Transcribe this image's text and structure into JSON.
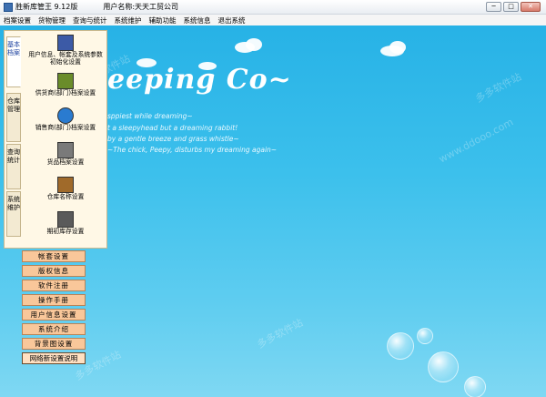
{
  "window": {
    "title": "胜新库管王  9.12版",
    "company": "用户名称:天天工贸公司",
    "controls": [
      "─",
      "□",
      "✕"
    ]
  },
  "menu": {
    "items": [
      "档案设置",
      "货物管理",
      "查询与统计",
      "系统维护",
      "辅助功能",
      "系统信息",
      "退出系统"
    ]
  },
  "side_tabs": [
    {
      "label": "基本档案",
      "active": true
    },
    {
      "label": "仓库管理",
      "active": false
    },
    {
      "label": "查询统计",
      "active": false
    },
    {
      "label": "系统维护",
      "active": false
    }
  ],
  "tools": [
    {
      "label": "用户信息、帐套及系统参数初始化设置",
      "icon": "books-icon",
      "color": "#3c5aa6"
    },
    {
      "label": "供货商(部门)档案设置",
      "icon": "binders-icon",
      "color": "#6a8c2a"
    },
    {
      "label": "销售商(部门)档案设置",
      "icon": "globe-icon",
      "color": "#2a7bd0"
    },
    {
      "label": "货品档案设置",
      "icon": "package-icon",
      "color": "#7a7a7a"
    },
    {
      "label": "仓库名称设置",
      "icon": "warehouse-icon",
      "color": "#a06a2a"
    },
    {
      "label": "期初库存设置",
      "icon": "printer-icon",
      "color": "#5a5a5a"
    }
  ],
  "buttons": [
    "帐套设置",
    "版权信息",
    "软件注册",
    "操作手册",
    "用户信息设置",
    "系统介绍",
    "背景图设置",
    "网络新设置说明"
  ],
  "background": {
    "brand": "eeping Co~",
    "taglines": [
      "sppiest while dreaming~",
      "t a sleepyhead but a dreaming rabbit!",
      "by a gentle breeze and grass whistle~",
      "~The chick, Peepy, disturbs my dreaming again~"
    ],
    "watermarks": [
      "多多软件站",
      "www.ddooo.com",
      "多多软件站",
      "多多软件站",
      "多多软件站"
    ]
  }
}
